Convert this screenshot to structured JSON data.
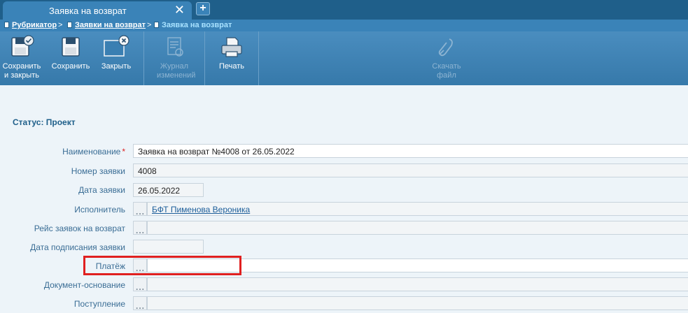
{
  "tab": {
    "title": "Заявка на возврат",
    "close": "✕",
    "add": "+"
  },
  "breadcrumb": {
    "items": [
      {
        "label": "Рубрикатор",
        "sep": ">"
      },
      {
        "label": "Заявки на возврат",
        "sep": ">"
      },
      {
        "label": "Заявка на возврат"
      }
    ]
  },
  "toolbar": {
    "save_close": "Сохранить и закрыть",
    "save": "Сохранить",
    "close": "Закрыть",
    "journal": "Журнал изменений",
    "print": "Печать",
    "download": "Скачать файл"
  },
  "status": "Статус: Проект",
  "form": {
    "name": {
      "label": "Наименование",
      "required": "*",
      "value": "Заявка на возврат №4008 от 26.05.2022"
    },
    "number": {
      "label": "Номер заявки",
      "value": "4008"
    },
    "date": {
      "label": "Дата заявки",
      "value": "26.05.2022"
    },
    "executor": {
      "label": "Исполнитель",
      "value": "БФТ Пименова Вероника"
    },
    "run": {
      "label": "Рейс заявок на возврат",
      "value": ""
    },
    "sign_date": {
      "label": "Дата подписания заявки",
      "value": ""
    },
    "payment": {
      "label": "Платёж",
      "value": ""
    },
    "base_doc": {
      "label": "Документ-основание",
      "value": ""
    },
    "receipt": {
      "label": "Поступление",
      "value": ""
    }
  },
  "picker_glyph": "...",
  "colors": {
    "accent": "#3a83b8",
    "highlight": "#e02020"
  }
}
